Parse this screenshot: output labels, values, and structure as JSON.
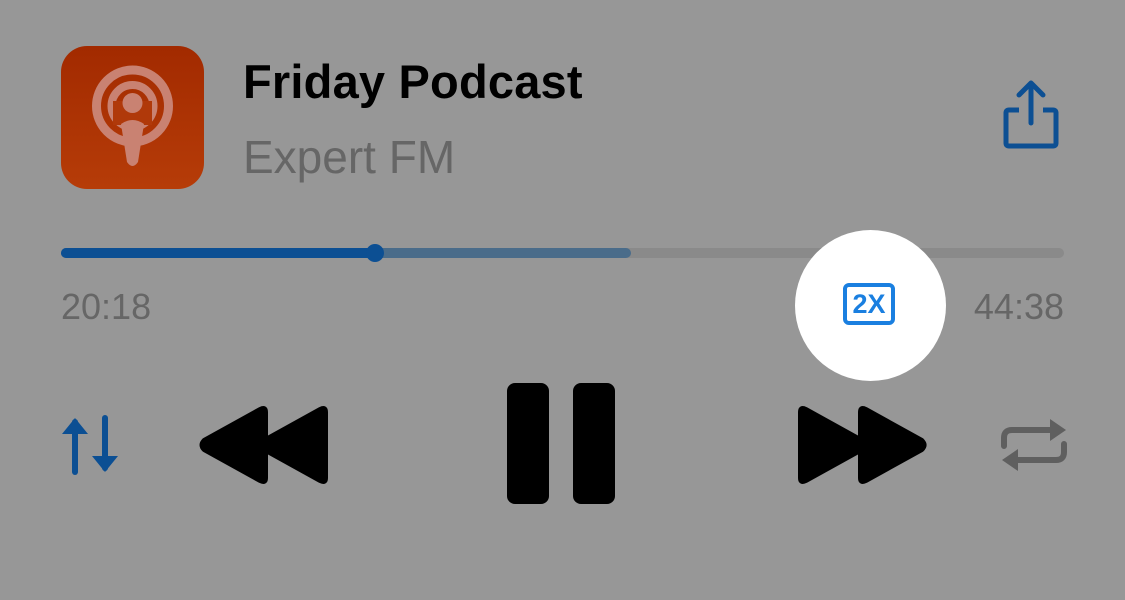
{
  "episode": {
    "title": "Friday Podcast",
    "show": "Expert FM",
    "artwork_icon": "podcasts-app-icon",
    "artwork_color": "#a62d02"
  },
  "playback": {
    "elapsed": "20:18",
    "total": "44:38",
    "progress_fraction": 0.313,
    "buffered_fraction": 0.568,
    "speed_label": "2X",
    "state": "playing"
  },
  "controls": {
    "share_icon": "share-icon",
    "queue_icon": "up-down-arrows-icon",
    "rewind_icon": "rewind-icon",
    "pause_icon": "pause-icon",
    "forward_icon": "fast-forward-icon",
    "repeat_icon": "repeat-icon"
  },
  "colors": {
    "accent": "#0c4f93",
    "highlight_accent": "#1a7fe0",
    "background": "#979797",
    "secondary_text": "#666666"
  }
}
